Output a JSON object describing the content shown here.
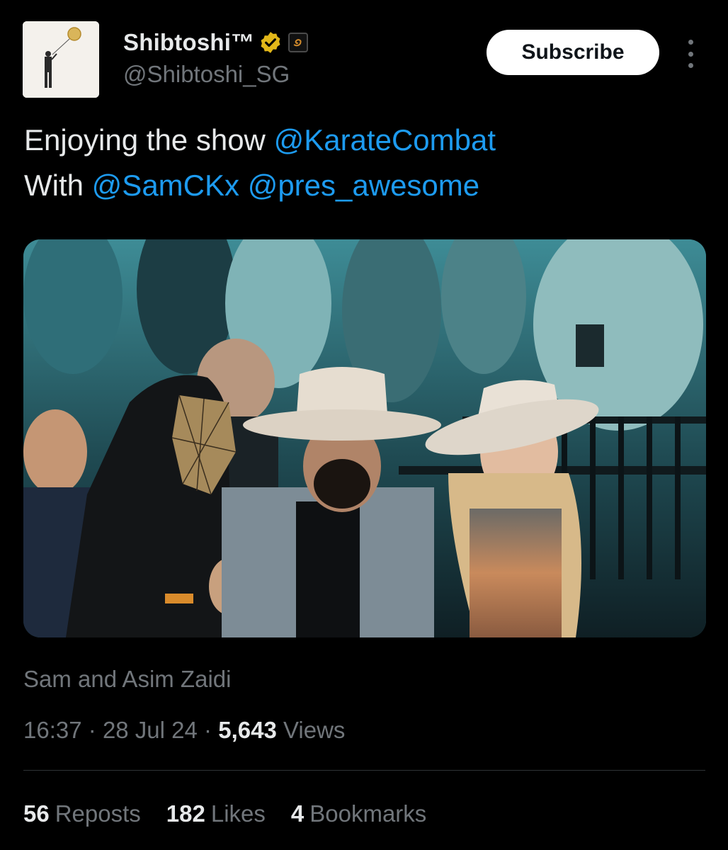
{
  "author": {
    "display_name": "Shibtoshi™",
    "handle": "@Shibtoshi_SG",
    "verified_icon": "gold-verified-badge-icon",
    "affiliation_icon": "affiliate-badge-icon"
  },
  "actions": {
    "subscribe_label": "Subscribe",
    "more_icon": "more-options-icon"
  },
  "tweet": {
    "line1_text": "Enjoying the show ",
    "line1_mention": "@KarateCombat",
    "line2_text": "With ",
    "line2_mention1": "@SamCKx",
    "line2_mention2": "@pres_awesome"
  },
  "media": {
    "caption": "Sam and Asim Zaidi"
  },
  "meta": {
    "time": "16:37",
    "date": "28 Jul 24",
    "views_count": "5,643",
    "views_label": "Views",
    "separator": "·"
  },
  "stats": {
    "reposts_count": "56",
    "reposts_label": "Reposts",
    "likes_count": "182",
    "likes_label": "Likes",
    "bookmarks_count": "4",
    "bookmarks_label": "Bookmarks"
  },
  "colors": {
    "background": "#000000",
    "text": "#e7e9ea",
    "secondary_text": "#71767b",
    "link": "#1d9bf0",
    "verified": "#e2b719"
  }
}
